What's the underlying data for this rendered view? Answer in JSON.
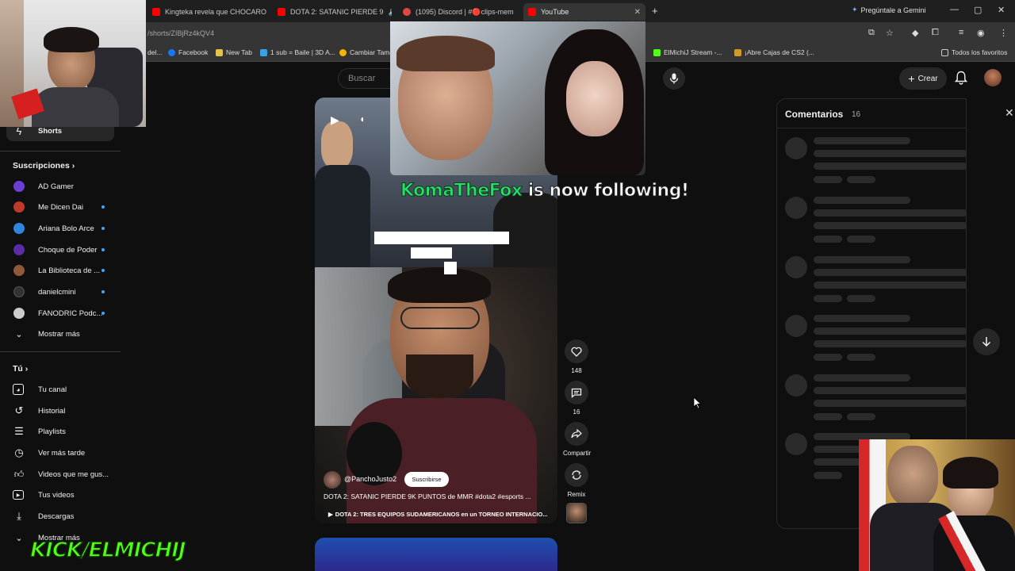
{
  "browser": {
    "tabs": [
      {
        "title": "Kingteka revela que CHOCARO"
      },
      {
        "title": "DOTA 2: SATANIC PIERDE 9"
      },
      {
        "title": "(1095) Discord | #🔴clips-mem"
      },
      {
        "title": "YouTube"
      }
    ],
    "gemini_label": "Pregúntale a Gemini",
    "url": "/shorts/ZIBjRz4kQV4",
    "bookmarks": [
      {
        "label": "del..."
      },
      {
        "label": "Facebook"
      },
      {
        "label": "New Tab"
      },
      {
        "label": "1 sub = Baile | 3D A..."
      },
      {
        "label": "Cambiar Tama"
      },
      {
        "label": "ElMichiJ Stream -..."
      },
      {
        "label": "¡Abre Cajas de CS2 (..."
      },
      {
        "label": "Todos los favoritos"
      }
    ]
  },
  "youtube": {
    "search_placeholder": "Buscar",
    "create_label": "Crear"
  },
  "sidebar": {
    "shorts_label": "Shorts",
    "subscriptions_heading": "Suscripciones",
    "channels": [
      {
        "label": "AD Gamer",
        "color": "#6a3fd6",
        "new": false
      },
      {
        "label": "Me Dicen Dai",
        "color": "#c0392b",
        "new": true
      },
      {
        "label": "Ariana Bolo Arce",
        "color": "#2e86de",
        "new": true
      },
      {
        "label": "Choque de Poder",
        "color": "#5b2ba8",
        "new": true
      },
      {
        "label": "La Biblioteca de ...",
        "color": "#8e5a3a",
        "new": true
      },
      {
        "label": "danielcmini",
        "color": "#333333",
        "new": true
      },
      {
        "label": "FANODRIC Podc...",
        "color": "#cccccc",
        "new": true
      }
    ],
    "show_more": "Mostrar más",
    "you_heading": "Tú",
    "you_items": [
      {
        "label": "Tu canal"
      },
      {
        "label": "Historial"
      },
      {
        "label": "Playlists"
      },
      {
        "label": "Ver más tarde"
      },
      {
        "label": "Videos que me gus..."
      },
      {
        "label": "Tus videos"
      },
      {
        "label": "Descargas"
      },
      {
        "label": "Mostrar más"
      }
    ]
  },
  "short": {
    "channel": "@PanchoJusto2",
    "subscribe_label": "Suscribirse",
    "title": "DOTA 2: SATANIC PIERDE 9K PUNTOS de MMR #dota2 #esports ...",
    "related": "DOTA 2: TRES EQUIPOS SUDAMERICANOS en un TORNEO INTERNACIO...",
    "likes": "148",
    "comments_count": "16",
    "share_label": "Compartir",
    "remix_label": "Remix"
  },
  "overlay": {
    "follow_name": "KomaTheFox",
    "follow_rest": " is now following!",
    "kick_banner": "KICK/ELMICHIJ"
  },
  "comments_panel": {
    "title": "Comentarios",
    "count": "16"
  }
}
